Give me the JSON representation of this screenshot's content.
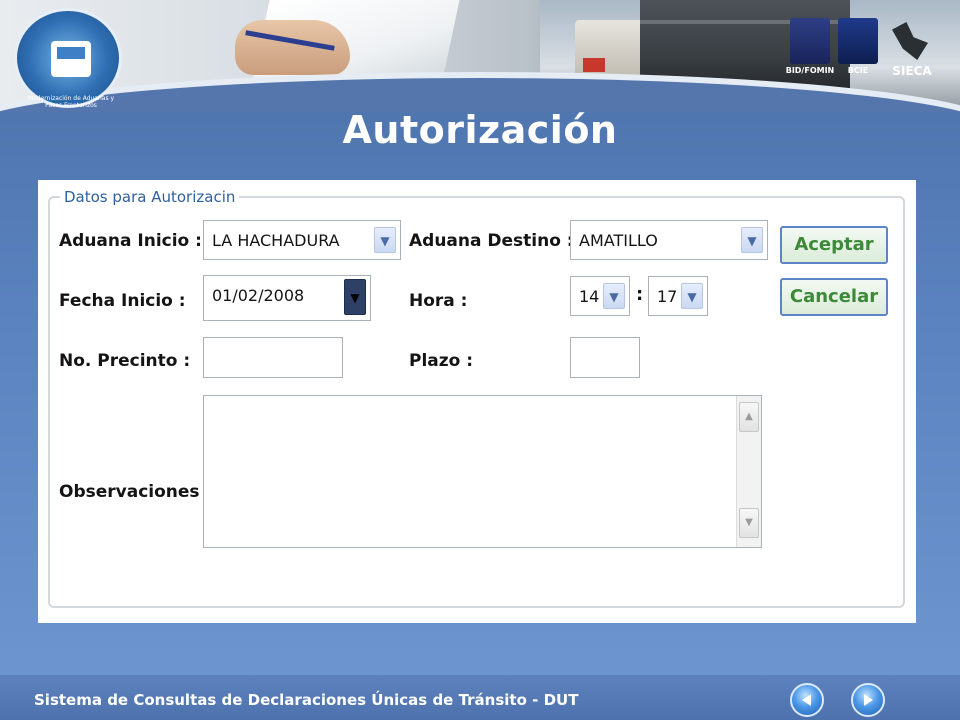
{
  "header": {
    "logo_caption": "Modernización de Aduanas y Pasos Fronterizos",
    "partners": [
      "BID/FOMIN",
      "BCIE",
      "SIECA"
    ]
  },
  "page": {
    "title": "Autorización"
  },
  "form": {
    "legend": "Datos para Autorizacin",
    "aduana_inicio": {
      "label": "Aduana Inicio :",
      "value": "LA HACHADURA"
    },
    "aduana_destino": {
      "label": "Aduana Destino :",
      "value": "AMATILLO"
    },
    "fecha_inicio": {
      "label": "Fecha Inicio :",
      "value": "01/02/2008"
    },
    "hora": {
      "label": "Hora :",
      "hour": "14",
      "minute": "17",
      "separator": ":"
    },
    "no_precinto": {
      "label": "No. Precinto :",
      "value": ""
    },
    "plazo": {
      "label": "Plazo :",
      "value": ""
    },
    "observaciones": {
      "label": "Observaciones",
      "value": ""
    },
    "buttons": {
      "accept": "Aceptar",
      "cancel": "Cancelar"
    }
  },
  "footer": {
    "text": "Sistema de Consultas de Declaraciones Únicas de Tránsito - DUT"
  },
  "colors": {
    "background": "#5b83bf",
    "button_text": "#3c8a39",
    "legend_text": "#2f5f9c"
  }
}
